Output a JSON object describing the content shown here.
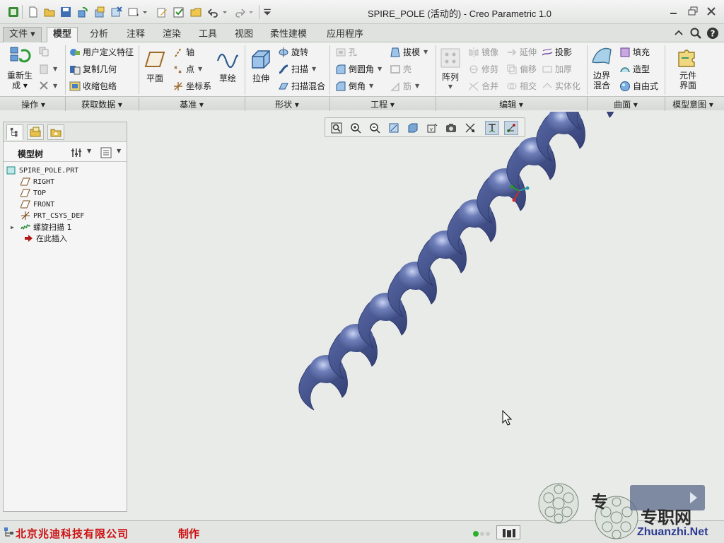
{
  "window": {
    "title": "SPIRE_POLE (活动的) - Creo Parametric 1.0"
  },
  "quick_access": [
    "new-icon",
    "open-icon",
    "save-icon",
    "regenerate-icon",
    "window-icon",
    "close-icon",
    "undo-icon",
    "redo-icon"
  ],
  "tabs": [
    {
      "label": "文件 ▾"
    },
    {
      "label": "模型"
    },
    {
      "label": "分析"
    },
    {
      "label": "注释"
    },
    {
      "label": "渲染"
    },
    {
      "label": "工具"
    },
    {
      "label": "视图"
    },
    {
      "label": "柔性建模"
    },
    {
      "label": "应用程序"
    }
  ],
  "ribbon": {
    "operations": {
      "regen": "重新生成",
      "regen_line1": "重新生",
      "regen_line2": "成 ▾"
    },
    "get_data": {
      "udf": "用户定义特征",
      "copy_geom": "复制几何",
      "shrinkwrap": "收缩包络"
    },
    "datum": {
      "plane": "平面",
      "axis": "轴",
      "point": "点",
      "csys": "坐标系",
      "sketch": "草绘"
    },
    "shapes": {
      "extrude": "拉伸",
      "revolve": "旋转",
      "sweep": "扫描",
      "swept_blend": "扫描混合"
    },
    "engineering": {
      "hole": "孔",
      "round": "倒圆角",
      "chamfer": "倒角",
      "draft": "拔模",
      "shell": "壳",
      "rib": "筋"
    },
    "editing": {
      "pattern": "阵列",
      "mirror": "镜像",
      "trim": "修剪",
      "merge": "合并",
      "extend": "延伸",
      "offset": "偏移",
      "intersect": "相交",
      "project": "投影",
      "thicken": "加厚",
      "solidify": "实体化"
    },
    "surfaces": {
      "boundary_blend_1": "边界",
      "boundary_blend_2": "混合",
      "fill": "填充",
      "style": "造型",
      "freestyle": "自由式"
    },
    "model_intent": {
      "component_1": "元件",
      "component_2": "界面"
    },
    "groups": [
      "操作 ▾",
      "获取数据 ▾",
      "基准 ▾",
      "形状 ▾",
      "工程 ▾",
      "编辑 ▾",
      "曲面 ▾",
      "模型意图 ▾"
    ]
  },
  "model_tree": {
    "title": "模型树",
    "items": [
      {
        "label": "SPIRE_POLE.PRT",
        "icon": "part-icon"
      },
      {
        "label": "RIGHT",
        "icon": "datum-plane-icon"
      },
      {
        "label": "TOP",
        "icon": "datum-plane-icon"
      },
      {
        "label": "FRONT",
        "icon": "datum-plane-icon"
      },
      {
        "label": "PRT_CSYS_DEF",
        "icon": "csys-icon"
      },
      {
        "label": "螺旋扫描 1",
        "icon": "helical-sweep-icon"
      },
      {
        "label": "在此插入",
        "icon": "insert-arrow-icon"
      }
    ]
  },
  "view_toolbar": [
    "refit-icon",
    "zoom-in-icon",
    "zoom-out-icon",
    "repaint-icon",
    "display-style-icon",
    "saved-views-icon",
    "view-manager-icon",
    "datum-display-icon",
    "spin-center-icon",
    "annotation-display-icon"
  ],
  "status": {
    "credit": "北京兆迪科技有限公司",
    "credit_suffix": "制作"
  },
  "watermark": {
    "site": "Zhuanzhi.Net",
    "cn": "专",
    "cn2": "专职网"
  },
  "colors": {
    "spiral_body": "#4a5a96",
    "credit": "#cc1111",
    "active_tab_bg": "#f2f3f2"
  }
}
